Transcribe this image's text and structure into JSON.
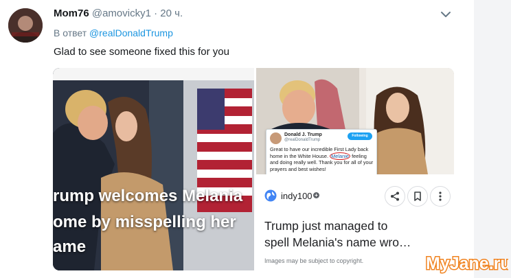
{
  "tweet": {
    "author_name": "Mom76",
    "author_handle": "@amovicky1",
    "separator": "·",
    "time": "20 ч.",
    "reply_prefix": "В ответ",
    "reply_to": "@realDonaldTrump",
    "text": "Glad to see someone fixed this for you"
  },
  "media": {
    "left_image_caption": [
      "rump welcomes Melania",
      "ome by misspelling her",
      "ame"
    ],
    "embedded_tweet": {
      "name": "Donald J. Trump",
      "handle": "@realDonaldTrump",
      "follow_label": "Following",
      "text_before": "Great to have our incredible First Lady back home in the White House.",
      "circled_word": "Melanie",
      "text_after": "feeling and doing really well. Thank you for all of your prayers and best wishes!"
    },
    "card": {
      "source": "indy100",
      "title_lines": [
        "Trump just managed to",
        "spell Melania's name wro…"
      ],
      "copyright_note": "Images may be subject to copyright."
    }
  },
  "watermark": "MyJane.ru",
  "colors": {
    "link": "#1b95e0",
    "muted": "#657786",
    "watermark_orange": "#f0821e"
  },
  "icons": {
    "more": "chevron-down-icon",
    "source": "globe-icon",
    "share": "share-icon",
    "save": "bookmark-icon",
    "menu": "more-vertical-icon"
  }
}
